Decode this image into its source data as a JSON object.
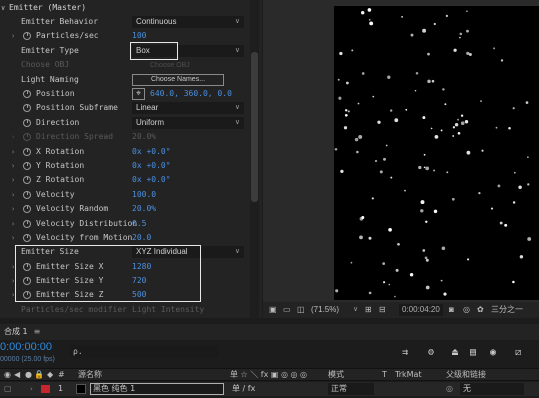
{
  "effect_controls": {
    "group_header": "Emitter (Master)",
    "rows": [
      {
        "label": "Emitter Behavior",
        "value": "Continuous",
        "kind": "dropdown"
      },
      {
        "label": "Particles/sec",
        "value": "100",
        "kind": "number"
      },
      {
        "label": "Emitter Type",
        "value": "Box",
        "kind": "dropdown"
      },
      {
        "label": "Choose OBJ",
        "value": "Choose OBJ",
        "kind": "disabled_button"
      },
      {
        "label": "Light Naming",
        "value": "Choose Names...",
        "kind": "button"
      },
      {
        "label": "Position",
        "value": "640.0, 360.0, 0.0",
        "kind": "point"
      },
      {
        "label": "Position Subframe",
        "value": "Linear",
        "kind": "dropdown"
      },
      {
        "label": "Direction",
        "value": "Uniform",
        "kind": "dropdown"
      },
      {
        "label": "Direction Spread",
        "value": "20.0%",
        "kind": "disabled"
      },
      {
        "label": "X Rotation",
        "value": "0x +0.0°",
        "kind": "number"
      },
      {
        "label": "Y Rotation",
        "value": "0x +0.0°",
        "kind": "number"
      },
      {
        "label": "Z Rotation",
        "value": "0x +0.0°",
        "kind": "number"
      },
      {
        "label": "Velocity",
        "value": "100.0",
        "kind": "number"
      },
      {
        "label": "Velocity Random",
        "value": "20.0%",
        "kind": "number"
      },
      {
        "label": "Velocity Distribution",
        "value": "0.5",
        "kind": "number"
      },
      {
        "label": "Velocity from Motion",
        "value": "20.0",
        "kind": "number"
      },
      {
        "label": "Emitter Size",
        "value": "XYZ Individual",
        "kind": "dropdown"
      },
      {
        "label": "Emitter Size X",
        "value": "1280",
        "kind": "number"
      },
      {
        "label": "Emitter Size Y",
        "value": "720",
        "kind": "number"
      },
      {
        "label": "Emitter Size Z",
        "value": "500",
        "kind": "number"
      },
      {
        "label": "Particles/sec modifier",
        "value": "Light Intensity",
        "kind": "disabled"
      }
    ]
  },
  "viewer": {
    "zoom": "(71.5%)",
    "timecode": "0:00:04:20",
    "resolution": "三分之一",
    "icons": [
      "monitor-icon",
      "grid-icon",
      "region-icon",
      "camera-icon",
      "channels-icon",
      "color-wheel-icon"
    ]
  },
  "timeline": {
    "tab_label": "合成 1",
    "tab_menu": "≡",
    "current_time": "0:00:00:00",
    "fps": "00000 (25.00 fps)",
    "search_placeholder": "ρ.",
    "columns": {
      "hash": "#",
      "source_name": "源名称",
      "switches": "单 ☆ ＼ fx ▣ ◎ ◎ ◎",
      "mode": "模式",
      "t": "T",
      "trkmat": "TrkMat",
      "parent": "父级和链接"
    },
    "layers": [
      {
        "number": "1",
        "name": "黑色 纯色 1",
        "label_color": "#c6262e",
        "switches": "单 / fx",
        "mode": "正常",
        "parent": "无"
      }
    ]
  }
}
